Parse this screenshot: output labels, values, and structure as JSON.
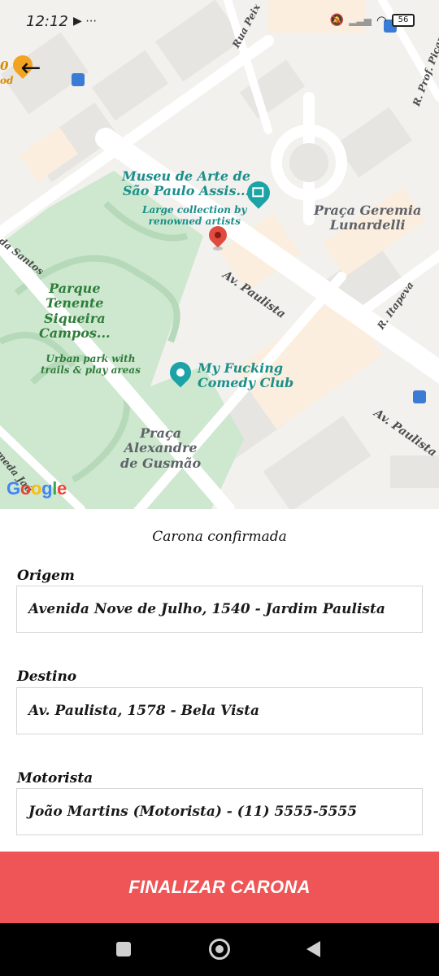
{
  "status_bar": {
    "time": "12:12",
    "left_icons": "▶ ⋯",
    "battery": "56"
  },
  "map": {
    "museum_name": "Museu de Arte de\nSão Paulo Assis...",
    "museum_desc": "Large collection by\nrenowned artists",
    "park_name": "Parque\nTenente\nSiqueira\nCampos...",
    "park_desc": "Urban park with\ntrails & play areas",
    "praca_geremia": "Praça Geremia\nLunardelli",
    "comedy_club": "My Fucking\nComedy Club",
    "praca_alexandre": "Praça\nAlexandre\nde Gusmão",
    "street_paulista": "Av. Paulista",
    "street_paulista_2": "Av. Paulista",
    "street_itapeva": "R. Itapeva",
    "street_santos": "da Santos",
    "street_jau": "meda Jaú",
    "street_peix": "Rua Peix",
    "street_picao": "R. Prof. Picaro",
    "poi_left_top": "0",
    "poi_left_bottom": "od",
    "google_logo": "Google",
    "colors": {
      "accent": "#ef5556",
      "park_green": "#cde8cf",
      "water_teal": "#1b8f8a",
      "pin_red": "#e04a3f"
    }
  },
  "panel": {
    "title": "Carona confirmada",
    "origin_label": "Origem",
    "origin_value": "Avenida Nove de Julho, 1540 - Jardim Paulista",
    "dest_label": "Destino",
    "dest_value": "Av. Paulista, 1578 - Bela Vista",
    "driver_label": "Motorista",
    "driver_value": "João Martins (Motorista) - (11) 5555-5555"
  },
  "finish_button": "FINALIZAR CARONA",
  "icons": {
    "back": "back-arrow-icon",
    "map_pin": "map-pin-icon",
    "museum": "museum-icon",
    "theater": "theater-icon",
    "bus": "bus-stop-icon",
    "wifi": "wifi-icon",
    "battery": "battery-icon"
  }
}
